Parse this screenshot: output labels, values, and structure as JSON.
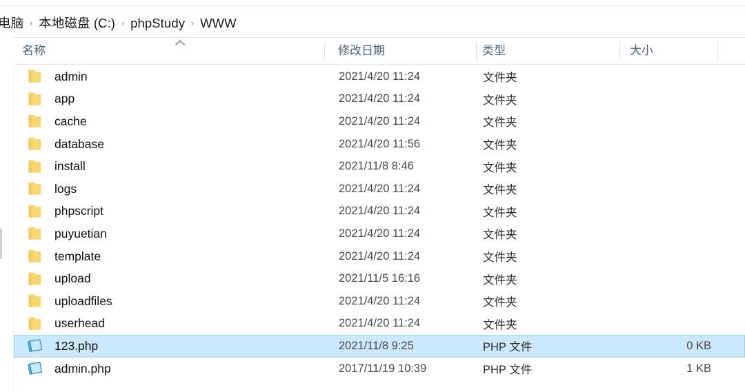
{
  "window": {
    "app": "File Explorer",
    "breadcrumb": {
      "items": [
        "电脑",
        "本地磁盘 (C:)",
        "phpStudy",
        "WWW"
      ],
      "separator": "›"
    }
  },
  "columns": {
    "name": "名称",
    "date_modified": "修改日期",
    "type": "类型",
    "size": "大小",
    "sort_column": "名称",
    "sort_direction": "ascending",
    "sort_icon": "chevron-up-icon"
  },
  "colors": {
    "selection_fill": "#cce8ff",
    "selection_border": "#9ad2f5",
    "header_text": "#4c6378",
    "folder_icon": "#f7d774",
    "php_icon": "#5bb8e8"
  },
  "files": [
    {
      "name": "admin",
      "date": "2021/4/20 11:24",
      "type": "文件夹",
      "size": "",
      "icon": "folder-icon",
      "selected": false
    },
    {
      "name": "app",
      "date": "2021/4/20 11:24",
      "type": "文件夹",
      "size": "",
      "icon": "folder-icon",
      "selected": false
    },
    {
      "name": "cache",
      "date": "2021/4/20 11:24",
      "type": "文件夹",
      "size": "",
      "icon": "folder-icon",
      "selected": false
    },
    {
      "name": "database",
      "date": "2021/4/20 11:56",
      "type": "文件夹",
      "size": "",
      "icon": "folder-icon",
      "selected": false
    },
    {
      "name": "install",
      "date": "2021/11/8 8:46",
      "type": "文件夹",
      "size": "",
      "icon": "folder-icon",
      "selected": false
    },
    {
      "name": "logs",
      "date": "2021/4/20 11:24",
      "type": "文件夹",
      "size": "",
      "icon": "folder-icon",
      "selected": false
    },
    {
      "name": "phpscript",
      "date": "2021/4/20 11:24",
      "type": "文件夹",
      "size": "",
      "icon": "folder-icon",
      "selected": false
    },
    {
      "name": "puyuetian",
      "date": "2021/4/20 11:24",
      "type": "文件夹",
      "size": "",
      "icon": "folder-icon",
      "selected": false
    },
    {
      "name": "template",
      "date": "2021/4/20 11:24",
      "type": "文件夹",
      "size": "",
      "icon": "folder-icon",
      "selected": false
    },
    {
      "name": "upload",
      "date": "2021/11/5 16:16",
      "type": "文件夹",
      "size": "",
      "icon": "folder-icon",
      "selected": false
    },
    {
      "name": "uploadfiles",
      "date": "2021/4/20 11:24",
      "type": "文件夹",
      "size": "",
      "icon": "folder-icon",
      "selected": false
    },
    {
      "name": "userhead",
      "date": "2021/4/20 11:24",
      "type": "文件夹",
      "size": "",
      "icon": "folder-icon",
      "selected": false
    },
    {
      "name": "123.php",
      "date": "2021/11/8 9:25",
      "type": "PHP 文件",
      "size": "0 KB",
      "icon": "php-file-icon",
      "selected": true
    },
    {
      "name": "admin.php",
      "date": "2017/11/19 10:39",
      "type": "PHP 文件",
      "size": "1 KB",
      "icon": "php-file-icon",
      "selected": false
    }
  ]
}
